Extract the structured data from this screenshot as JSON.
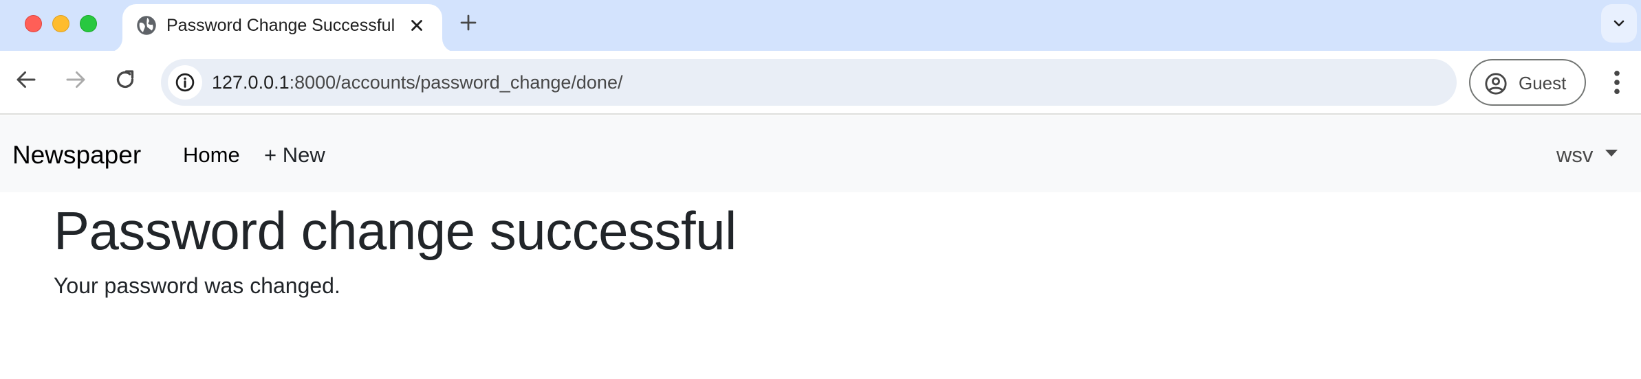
{
  "browser": {
    "tab": {
      "title": "Password Change Successful",
      "favicon": "globe-icon"
    },
    "toolbar": {
      "url_host": "127.0.0.1",
      "url_path": ":8000/accounts/password_change/done/",
      "profile_label": "Guest"
    }
  },
  "page": {
    "navbar": {
      "brand": "Newspaper",
      "links": [
        {
          "label": "Home"
        },
        {
          "label": "+ New"
        }
      ],
      "user_menu": "wsv"
    },
    "heading": "Password change successful",
    "message": "Your password was changed."
  }
}
